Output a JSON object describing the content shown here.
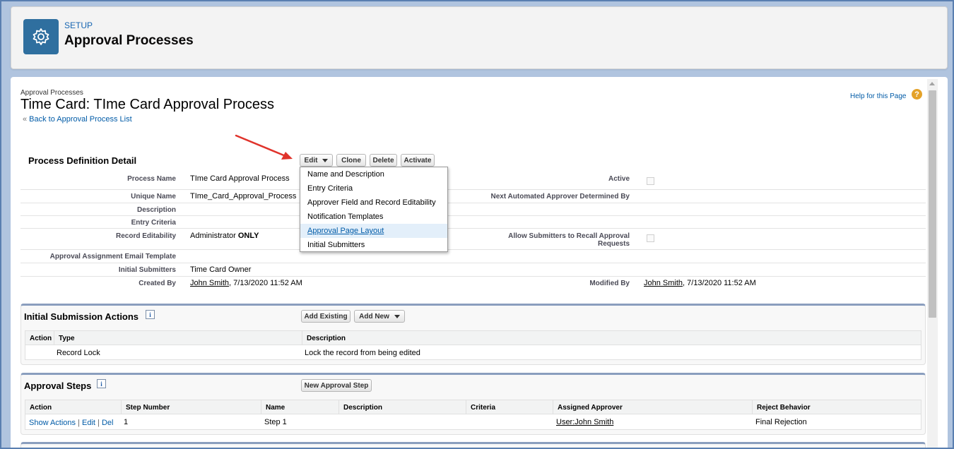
{
  "header": {
    "setup_label": "SETUP",
    "title": "Approval Processes",
    "icon": "gear-icon"
  },
  "breadcrumb": "Approval Processes",
  "page_title": "Time Card: TIme Card Approval Process",
  "back_link": "Back to Approval Process List",
  "help": {
    "label": "Help for this Page",
    "icon_glyph": "?"
  },
  "process_detail": {
    "title": "Process Definition Detail",
    "buttons": {
      "edit": "Edit",
      "clone": "Clone",
      "delete": "Delete",
      "activate": "Activate"
    },
    "fields": {
      "process_name": {
        "label": "Process Name",
        "value": "TIme Card Approval Process"
      },
      "unique_name": {
        "label": "Unique Name",
        "value": "TIme_Card_Approval_Process"
      },
      "description": {
        "label": "Description",
        "value": ""
      },
      "entry_criteria": {
        "label": "Entry Criteria",
        "value": ""
      },
      "record_editability": {
        "label": "Record Editability",
        "value": "Administrator ",
        "value_bold": "ONLY"
      },
      "email_template": {
        "label": "Approval Assignment Email Template",
        "value": ""
      },
      "initial_submitters": {
        "label": "Initial Submitters",
        "value": "Time Card Owner"
      },
      "created_by": {
        "label": "Created By",
        "user": "John Smith",
        "date": ", 7/13/2020 11:52 AM"
      },
      "active": {
        "label": "Active",
        "checked": false
      },
      "next_approver": {
        "label": "Next Automated Approver Determined By",
        "value": ""
      },
      "allow_recall": {
        "label_line1": "Allow Submitters to Recall Approval",
        "label_line2": "Requests",
        "checked": false
      },
      "modified_by": {
        "label": "Modified By",
        "user": "John Smith",
        "date": ", 7/13/2020 11:52 AM"
      }
    }
  },
  "edit_menu": {
    "items": [
      {
        "label": "Name and Description"
      },
      {
        "label": "Entry Criteria"
      },
      {
        "label": "Approver Field and Record Editability"
      },
      {
        "label": "Notification Templates"
      },
      {
        "label": "Approval Page Layout",
        "highlighted": true
      },
      {
        "label": "Initial Submitters"
      }
    ]
  },
  "initial_submission": {
    "title": "Initial Submission Actions",
    "info_glyph": "i",
    "buttons": {
      "add_existing": "Add Existing",
      "add_new": "Add New"
    },
    "columns": [
      "Action",
      "Type",
      "Description"
    ],
    "rows": [
      {
        "action": "",
        "type": "Record Lock",
        "description": "Lock the record from being edited"
      }
    ]
  },
  "approval_steps": {
    "title": "Approval Steps",
    "info_glyph": "i",
    "buttons": {
      "new_step": "New Approval Step"
    },
    "columns": [
      "Action",
      "Step Number",
      "Name",
      "Description",
      "Criteria",
      "Assigned Approver",
      "Reject Behavior"
    ],
    "rows": [
      {
        "show_actions": "Show Actions",
        "sep1": " | ",
        "edit": "Edit",
        "sep2": " | ",
        "del": "Del",
        "step_number": "1",
        "name": "Step 1",
        "description": "",
        "criteria": "",
        "assigned_approver": "User:John Smith",
        "reject_behavior": "Final Rejection"
      }
    ]
  },
  "colors": {
    "background": "#b0c4df",
    "header_icon": "#2f6f9f",
    "link": "#015ba7",
    "arrow": "#e0332b",
    "section_border": "#8a9ebe"
  }
}
